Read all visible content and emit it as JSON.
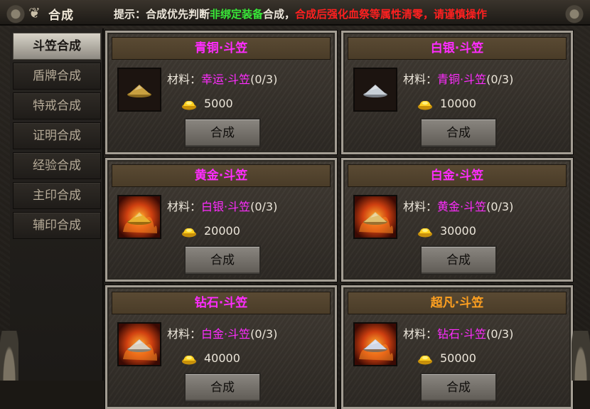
{
  "window": {
    "title": "合成",
    "hint": {
      "prefix": "提示：合成优先判断",
      "green": "非绑定装备",
      "mid": "合成，",
      "red": "合成后强化血祭等属性清零，请谨慎操作"
    }
  },
  "sidebar": {
    "tabs": [
      {
        "label": "斗笠合成",
        "active": true
      },
      {
        "label": "盾牌合成",
        "active": false
      },
      {
        "label": "特戒合成",
        "active": false
      },
      {
        "label": "证明合成",
        "active": false
      },
      {
        "label": "经验合成",
        "active": false
      },
      {
        "label": "主印合成",
        "active": false
      },
      {
        "label": "辅印合成",
        "active": false
      }
    ]
  },
  "cards": [
    {
      "title": "青铜·斗笠",
      "title_color": "#ff2cff",
      "material_label": "材料：",
      "material": "幸运·斗笠",
      "count": "(0/3)",
      "gold": "5000",
      "button": "合成",
      "icon": "bronze-hat-icon"
    },
    {
      "title": "白银·斗笠",
      "title_color": "#ff2cff",
      "material_label": "材料：",
      "material": "青铜·斗笠",
      "count": "(0/3)",
      "gold": "10000",
      "button": "合成",
      "icon": "silver-hat-icon"
    },
    {
      "title": "黄金·斗笠",
      "title_color": "#ff2cff",
      "material_label": "材料：",
      "material": "白银·斗笠",
      "count": "(0/3)",
      "gold": "20000",
      "button": "合成",
      "icon": "gold-hat-icon"
    },
    {
      "title": "白金·斗笠",
      "title_color": "#ff2cff",
      "material_label": "材料：",
      "material": "黄金·斗笠",
      "count": "(0/3)",
      "gold": "30000",
      "button": "合成",
      "icon": "platinum-hat-icon"
    },
    {
      "title": "钻石·斗笠",
      "title_color": "#ff2cff",
      "material_label": "材料：",
      "material": "白金·斗笠",
      "count": "(0/3)",
      "gold": "40000",
      "button": "合成",
      "icon": "diamond-hat-icon"
    },
    {
      "title": "超凡·斗笠",
      "title_color": "#ffa020",
      "material_label": "材料：",
      "material": "钻石·斗笠",
      "count": "(0/3)",
      "gold": "50000",
      "button": "合成",
      "icon": "transcendent-hat-icon"
    }
  ]
}
